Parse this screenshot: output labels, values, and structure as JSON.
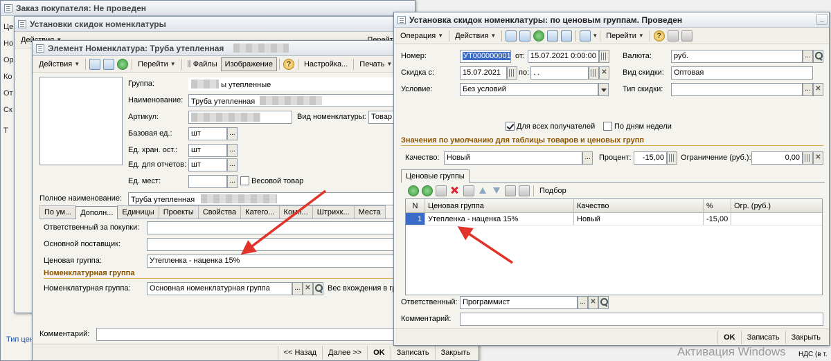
{
  "order_window": {
    "title": "Заказ покупателя: Не проведен",
    "side_labels": [
      "Це",
      "Но",
      "Ор",
      "Ко",
      "От",
      "Ск",
      "Т"
    ],
    "bottom_link": "Тип цен"
  },
  "discount_bg_window": {
    "title": "Установки скидок номенклатуры",
    "toolbar": {
      "actions": "Действия",
      "goto": "Перейти"
    }
  },
  "item_window": {
    "title": "Элемент Номенклатура: Труба утепленная",
    "toolbar": {
      "actions": "Действия",
      "goto": "Перейти",
      "files": "Файлы",
      "image": "Изображение",
      "settings": "Настройка...",
      "print": "Печать"
    },
    "fields": {
      "group_label": "Группа:",
      "group_value": "ы утепленные",
      "name_label": "Наименование:",
      "name_value": "Труба утепленная",
      "article_label": "Артикул:",
      "kind_label": "Вид номенклатуры:",
      "kind_value": "Товар",
      "base_unit_label": "Базовая ед.:",
      "base_unit_value": "шт",
      "storage_unit_label": "Ед. хран. ост.:",
      "storage_unit_value": "шт",
      "report_unit_label": "Ед. для отчетов:",
      "report_unit_value": "шт",
      "place_unit_label": "Ед. мест:",
      "weight_label": "Весовой товар",
      "full_name_label": "Полное наименование:",
      "full_name_value": "Труба утепленная"
    },
    "tabs": [
      "По ум...",
      "Дополн...",
      "Единицы",
      "Проекты",
      "Свойства",
      "Катего...",
      "Комп...",
      "Штрихк...",
      "Места"
    ],
    "tab_fields": {
      "buyer_label": "Ответственный за покупки:",
      "supplier_label": "Основной поставщик:",
      "price_group_label": "Ценовая группа:",
      "price_group_value": "Утепленка - наценка 15%",
      "section_title": "Номенклатурная группа",
      "nom_group_label": "Номенклатурная группа:",
      "nom_group_value": "Основная номенклатурная группа",
      "weight_entry_label": "Вес вхождения в гр"
    },
    "comment_label": "Комментарий:",
    "bottom": {
      "back": "<< Назад",
      "next": "Далее >>",
      "ok": "OK",
      "save": "Записать",
      "close": "Закрыть"
    }
  },
  "discount_window": {
    "title": "Установка скидок номенклатуры: по ценовым группам. Проведен",
    "toolbar": {
      "operation": "Операция",
      "actions": "Действия",
      "goto": "Перейти"
    },
    "fields": {
      "number_label": "Номер:",
      "number_value": "УТ000000001",
      "from_label": "от:",
      "from_value": "15.07.2021  0:00:00",
      "currency_label": "Валюта:",
      "currency_value": "руб.",
      "discount_from_label": "Скидка с:",
      "discount_from_value": "15.07.2021",
      "to_label": "по:",
      "to_value": "  .  .",
      "discount_kind_label": "Вид скидки:",
      "discount_kind_value": "Оптовая",
      "condition_label": "Условие:",
      "condition_value": "Без условий",
      "discount_type_label": "Тип скидки:",
      "all_recipients_label": "Для всех получателей",
      "by_weekdays_label": "По дням недели"
    },
    "section_title": "Значения по умолчанию для таблицы товаров и ценовых групп",
    "quality_label": "Качество:",
    "quality_value": "Новый",
    "percent_label": "Процент:",
    "percent_value": "-15,00",
    "limit_label": "Ограничение (руб.):",
    "limit_value": "0,00",
    "tab_label": "Ценовые группы",
    "grid_toolbar_pick": "Подбор",
    "grid": {
      "columns": [
        "N",
        "Ценовая группа",
        "Качество",
        "%",
        "Огр. (руб.)"
      ],
      "rows": [
        {
          "n": "1",
          "group": "Утепленка - наценка 15%",
          "quality": "Новый",
          "percent": "-15,00",
          "limit": ""
        }
      ]
    },
    "responsible_label": "Ответственный:",
    "responsible_value": "Программист",
    "comment_label": "Комментарий:",
    "bottom": {
      "ok": "OK",
      "save": "Записать",
      "close": "Закрыть"
    }
  },
  "desktop": {
    "watermark": "Активация Windows",
    "nds_text": "НДС (в т."
  },
  "colors": {
    "arrow": "#e0332a",
    "selection": "#3a6cc7",
    "section": "#8a5300"
  }
}
